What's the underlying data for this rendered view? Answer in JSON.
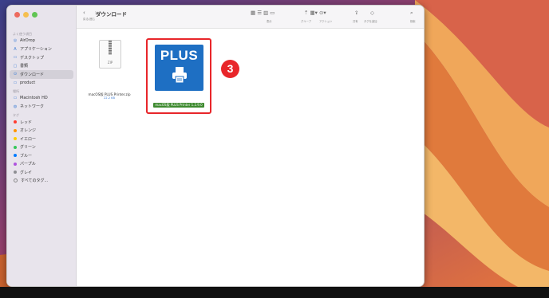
{
  "window": {
    "title": "ダウンロード",
    "back_forward_label": "戻る/進む",
    "traffic_lights": [
      "#ed6a5e",
      "#f5bf4f",
      "#61c554"
    ]
  },
  "sidebar": {
    "sections": [
      {
        "header": "よく使う項目",
        "items": [
          {
            "label": "AirDrop",
            "icon": "airdrop-icon",
            "glyph": "◎"
          },
          {
            "label": "アプリケーション",
            "icon": "applications-icon",
            "glyph": "A"
          },
          {
            "label": "デスクトップ",
            "icon": "desktop-icon",
            "glyph": "▭"
          },
          {
            "label": "書類",
            "icon": "document-icon",
            "glyph": "▢"
          },
          {
            "label": "ダウンロード",
            "icon": "download-icon",
            "glyph": "⊙",
            "active": true
          },
          {
            "label": "product",
            "icon": "folder-icon",
            "glyph": "▭"
          }
        ]
      },
      {
        "header": "場所",
        "items": [
          {
            "label": "Macintosh HD",
            "icon": "disk-icon",
            "glyph": "▭"
          },
          {
            "label": "ネットワーク",
            "icon": "network-icon",
            "glyph": "◍"
          }
        ]
      },
      {
        "header": "タグ",
        "tags": [
          {
            "label": "レッド",
            "color": "#ff3b30"
          },
          {
            "label": "オレンジ",
            "color": "#ff9500"
          },
          {
            "label": "イエロー",
            "color": "#ffcc00"
          },
          {
            "label": "グリーン",
            "color": "#34c759"
          },
          {
            "label": "ブルー",
            "color": "#007aff"
          },
          {
            "label": "パープル",
            "color": "#af52de"
          },
          {
            "label": "グレイ",
            "color": "#8e8e93"
          },
          {
            "label": "すべてのタグ...",
            "color": "outline"
          }
        ]
      }
    ]
  },
  "toolbar": {
    "view_label": "表示",
    "group_label": "グループ",
    "action_label": "アクション",
    "share_label": "共有",
    "tag_label": "タグを追加",
    "search_label": "検索"
  },
  "files": [
    {
      "name": "macOS版 PLUS Printer.zip",
      "size": "22.2 KB",
      "kind_label": "ZIP"
    },
    {
      "name": "macOS版 PLUS Printer 1.2.9.0",
      "icon_text": "PLUS",
      "selected": true
    }
  ],
  "annotation": {
    "step": "3",
    "color": "#e8262a"
  },
  "colors": {
    "accent": "#1e6fc3",
    "selection": "#3d8a2f",
    "highlight": "#e8262a"
  }
}
